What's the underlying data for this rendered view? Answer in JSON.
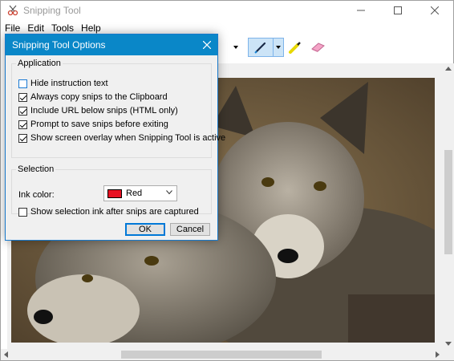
{
  "window": {
    "title": "Snipping Tool",
    "controls": [
      "minimize",
      "maximize",
      "close"
    ]
  },
  "menu": [
    "File",
    "Edit",
    "Tools",
    "Help"
  ],
  "toolbar": {
    "icons": [
      "pen-icon",
      "highlighter-icon",
      "eraser-icon"
    ],
    "active_tool": "pen"
  },
  "canvas": {
    "image_subject": "two arctic fox cubs"
  },
  "dialog": {
    "title": "Snipping Tool Options",
    "application_group": {
      "legend": "Application",
      "options": [
        {
          "label": "Hide instruction text",
          "checked": false
        },
        {
          "label": "Always copy snips to the Clipboard",
          "checked": true
        },
        {
          "label": "Include URL below snips (HTML only)",
          "checked": true
        },
        {
          "label": "Prompt to save snips before exiting",
          "checked": true
        },
        {
          "label": "Show screen overlay when Snipping Tool is active",
          "checked": true
        }
      ]
    },
    "selection_group": {
      "legend": "Selection",
      "ink_color_label": "Ink color:",
      "ink_color_value": "Red",
      "ink_color_hex": "#e81123",
      "show_ink": {
        "label": "Show selection ink after snips are captured",
        "checked": false
      }
    },
    "ok_label": "OK",
    "cancel_label": "Cancel"
  },
  "colors": {
    "dialog_titlebar": "#0a87c8",
    "selected_tool": "#cce4f7"
  }
}
